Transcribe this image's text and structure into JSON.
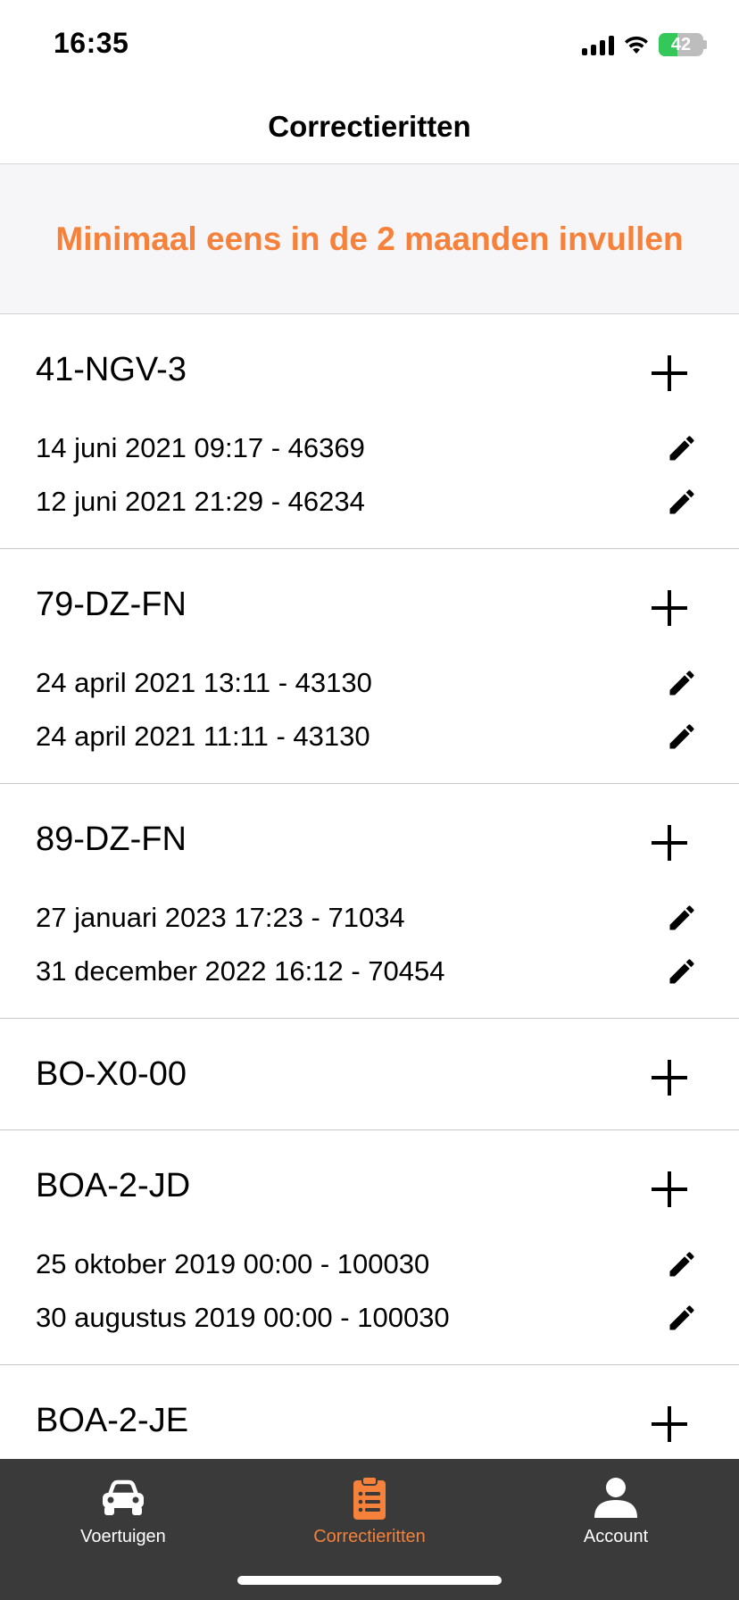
{
  "status_bar": {
    "time": "16:35",
    "battery_level": "42",
    "battery_percent": 42
  },
  "nav": {
    "title": "Correctieritten"
  },
  "banner": {
    "text": "Minimaal eens in de 2 maanden invullen"
  },
  "vehicles": [
    {
      "plate": "41-NGV-3",
      "rides": [
        "14 juni 2021 09:17 - 46369",
        "12 juni 2021 21:29 - 46234"
      ]
    },
    {
      "plate": "79-DZ-FN",
      "rides": [
        "24 april 2021 13:11 - 43130",
        "24 april 2021 11:11 - 43130"
      ]
    },
    {
      "plate": "89-DZ-FN",
      "rides": [
        "27 januari 2023 17:23 - 71034",
        "31 december 2022 16:12 - 70454"
      ]
    },
    {
      "plate": "BO-X0-00",
      "rides": []
    },
    {
      "plate": "BOA-2-JD",
      "rides": [
        "25 oktober 2019 00:00 - 100030",
        "30 augustus 2019 00:00 - 100030"
      ]
    },
    {
      "plate": "BOA-2-JE",
      "rides": []
    }
  ],
  "tabs": [
    {
      "label": "Voertuigen",
      "icon": "car-icon",
      "active": false
    },
    {
      "label": "Correctieritten",
      "icon": "clipboard-list-icon",
      "active": true
    },
    {
      "label": "Account",
      "icon": "user-icon",
      "active": false
    }
  ],
  "colors": {
    "accent": "#f5813a",
    "tab_bar_bg": "#3a3a3a",
    "banner_bg": "#f6f6f8",
    "battery_green": "#34c759"
  }
}
